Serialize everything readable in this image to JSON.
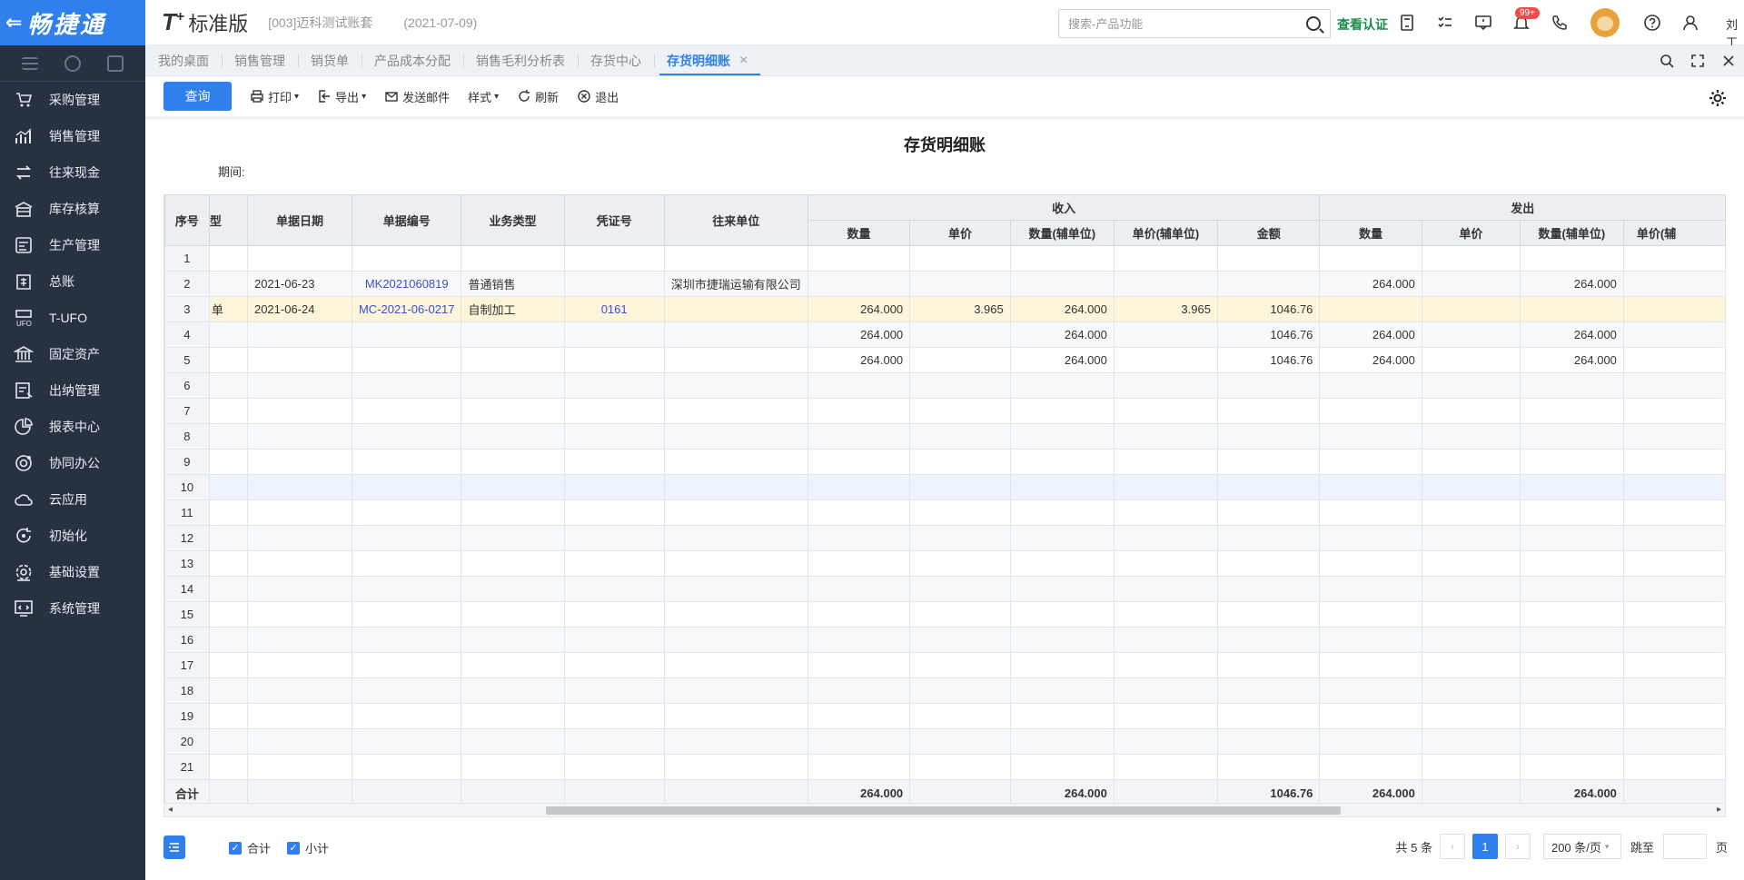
{
  "brand": {
    "name": "畅捷通"
  },
  "sidebar": {
    "items": [
      {
        "label": "采购管理",
        "icon": "purchase-icon"
      },
      {
        "label": "销售管理",
        "icon": "sales-chart-icon"
      },
      {
        "label": "往来现金",
        "icon": "exchange-icon"
      },
      {
        "label": "库存核算",
        "icon": "warehouse-icon"
      },
      {
        "label": "生产管理",
        "icon": "production-icon"
      },
      {
        "label": "总账",
        "icon": "ledger-icon"
      },
      {
        "label": "T-UFO",
        "icon": "ufo-icon"
      },
      {
        "label": "固定资产",
        "icon": "bank-icon"
      },
      {
        "label": "出纳管理",
        "icon": "cashier-icon"
      },
      {
        "label": "报表中心",
        "icon": "pie-chart-icon"
      },
      {
        "label": "协同办公",
        "icon": "collab-icon"
      },
      {
        "label": "云应用",
        "icon": "cloud-icon"
      },
      {
        "label": "初始化",
        "icon": "refresh-icon"
      },
      {
        "label": "基础设置",
        "icon": "settings-icon"
      },
      {
        "label": "系统管理",
        "icon": "system-icon"
      }
    ]
  },
  "header": {
    "logo_t": "T",
    "logo_plus": "+",
    "edition": "标准版",
    "account": "[003]迈科测试账套",
    "account_date": "(2021-07-09)",
    "search_placeholder": "搜索-产品功能",
    "verify_label": "查看认证",
    "badge": "99+",
    "user": "刘工"
  },
  "tabs": [
    {
      "label": "我的桌面",
      "active": false
    },
    {
      "label": "销售管理",
      "active": false
    },
    {
      "label": "销货单",
      "active": false
    },
    {
      "label": "产品成本分配",
      "active": false
    },
    {
      "label": "销售毛利分析表",
      "active": false
    },
    {
      "label": "存货中心",
      "active": false
    },
    {
      "label": "存货明细账",
      "active": true,
      "close": "×"
    }
  ],
  "toolbar": {
    "query": "查询",
    "print": "打印",
    "export": "导出",
    "email": "发送邮件",
    "style": "样式",
    "refresh": "刷新",
    "exit": "退出"
  },
  "report": {
    "title": "存货明细账",
    "period_label": "期间:",
    "period_value": ""
  },
  "table": {
    "col_seq": "序号",
    "col_type_cut": "型",
    "col_date": "单据日期",
    "col_no": "单据编号",
    "col_biz": "业务类型",
    "col_voucher": "凭证号",
    "col_partner": "往来单位",
    "group_in": "收入",
    "group_out": "发出",
    "in_cols": [
      "数量",
      "单价",
      "数量(辅单位)",
      "单价(辅单位)",
      "金额"
    ],
    "out_cols": [
      "数量",
      "单价",
      "数量(辅单位)",
      "单价(辅"
    ],
    "rows": [
      {
        "seq": "1",
        "type": "",
        "date": "",
        "no": "",
        "biz": "",
        "voucher": "",
        "partner": "",
        "in_qty": "",
        "in_price": "",
        "in_qty_aux": "",
        "in_price_aux": "",
        "in_amount": "",
        "out_qty": "",
        "out_price": "",
        "out_qty_aux": "",
        "out_price_aux": ""
      },
      {
        "seq": "2",
        "type": "",
        "date": "2021-06-23",
        "no": "MK2021060819",
        "biz": "普通销售",
        "voucher": "",
        "partner": "深圳市捷瑞运输有限公司",
        "in_qty": "",
        "in_price": "",
        "in_qty_aux": "",
        "in_price_aux": "",
        "in_amount": "",
        "out_qty": "264.000",
        "out_price": "",
        "out_qty_aux": "264.000",
        "out_price_aux": ""
      },
      {
        "seq": "3",
        "type": "单",
        "date": "2021-06-24",
        "no": "MC-2021-06-0217",
        "biz": "自制加工",
        "voucher": "0161",
        "partner": "",
        "in_qty": "264.000",
        "in_price": "3.965",
        "in_qty_aux": "264.000",
        "in_price_aux": "3.965",
        "in_amount": "1046.76",
        "out_qty": "",
        "out_price": "",
        "out_qty_aux": "",
        "out_price_aux": ""
      },
      {
        "seq": "4",
        "type": "",
        "date": "",
        "no": "",
        "biz": "",
        "voucher": "",
        "partner": "",
        "in_qty": "264.000",
        "in_price": "",
        "in_qty_aux": "264.000",
        "in_price_aux": "",
        "in_amount": "1046.76",
        "out_qty": "264.000",
        "out_price": "",
        "out_qty_aux": "264.000",
        "out_price_aux": ""
      },
      {
        "seq": "5",
        "type": "",
        "date": "",
        "no": "",
        "biz": "",
        "voucher": "",
        "partner": "",
        "in_qty": "264.000",
        "in_price": "",
        "in_qty_aux": "264.000",
        "in_price_aux": "",
        "in_amount": "1046.76",
        "out_qty": "264.000",
        "out_price": "",
        "out_qty_aux": "264.000",
        "out_price_aux": ""
      },
      {
        "seq": "6"
      },
      {
        "seq": "7"
      },
      {
        "seq": "8"
      },
      {
        "seq": "9"
      },
      {
        "seq": "10"
      },
      {
        "seq": "11"
      },
      {
        "seq": "12"
      },
      {
        "seq": "13"
      },
      {
        "seq": "14"
      },
      {
        "seq": "15"
      },
      {
        "seq": "16"
      },
      {
        "seq": "17"
      },
      {
        "seq": "18"
      },
      {
        "seq": "19"
      },
      {
        "seq": "20"
      },
      {
        "seq": "21"
      }
    ],
    "total": {
      "label": "合计",
      "in_qty": "264.000",
      "in_qty_aux": "264.000",
      "in_amount": "1046.76",
      "out_qty": "264.000",
      "out_qty_aux": "264.000"
    }
  },
  "footer": {
    "chk_total": "合计",
    "chk_subtotal": "小计",
    "count": "共 5 条",
    "prev": "‹",
    "current_page": "1",
    "next": "›",
    "page_size": "200 条/页",
    "jump": "跳至",
    "page_unit": "页"
  },
  "colors": {
    "primary": "#2f80ed",
    "sidebar": "#283142",
    "selected_row": "#fdf5d9",
    "link": "#3a4fd1"
  }
}
